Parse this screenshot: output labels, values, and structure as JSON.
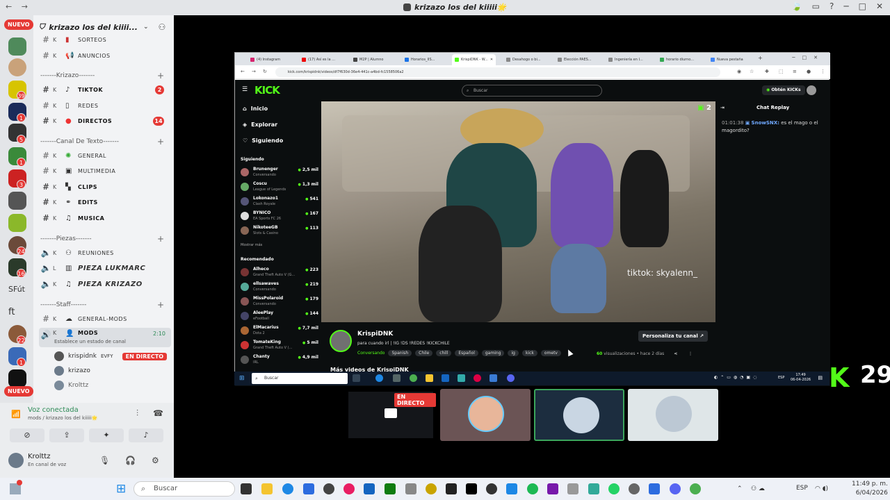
{
  "window": {
    "title": "krizazo los del kiiiii🌟",
    "back": "←",
    "forward": "→"
  },
  "rail": {
    "nuevo_top": "NUEVO",
    "nuevo_bottom": "NUEVO",
    "text_sfut": "SFút",
    "text_ft": "ft",
    "badges": [
      "39",
      "1",
      "5",
      "1",
      "3",
      "24",
      "16",
      "22",
      "1"
    ]
  },
  "server": {
    "name": "krizazo los del kiiii...",
    "categories": {
      "krizazo": "-------Krizazo-------",
      "texto": "-------Canal De Texto-------",
      "piezas": "-------Piezas-------",
      "staff": "-------Staff-------"
    },
    "channels": [
      {
        "k": "K",
        "label": "SORTEOS"
      },
      {
        "k": "K",
        "label": "ANUNCIOS"
      },
      {
        "k": "K",
        "label": "TIKTOK",
        "badge": "2"
      },
      {
        "k": "K",
        "label": "REDES"
      },
      {
        "k": "K",
        "label": "DIRECTOS",
        "badge": "14"
      },
      {
        "k": "K",
        "label": "GENERAL"
      },
      {
        "k": "K",
        "label": "MULTIMEDIA"
      },
      {
        "k": "K",
        "label": "CLIPS"
      },
      {
        "k": "K",
        "label": "EDITS"
      },
      {
        "k": "K",
        "label": "MUSICA"
      },
      {
        "k": "K",
        "label": "REUNIONES"
      },
      {
        "k": "L",
        "label": "PIEZA LUKMARC"
      },
      {
        "k": "K",
        "label": "PIEZA KRIZAZO"
      },
      {
        "k": "K",
        "label": "GENERAL-MODS"
      },
      {
        "k": "K",
        "label": "MODS",
        "time": "2:10",
        "status": "Establece un estado de canal"
      }
    ],
    "voice_users": [
      {
        "name": "krispidnk",
        "tag": "EVFY",
        "live": "EN DIRECTO"
      },
      {
        "name": "krizazo"
      },
      {
        "name": "Krolttz"
      }
    ]
  },
  "voice_panel": {
    "connected": "Voz conectada",
    "location": "mods / krizazo los del kiiiii🌟",
    "user_name": "Krolttz",
    "user_status": "En canal de voz"
  },
  "browser": {
    "tabs": [
      "(4) Instagram",
      "(17) Así es la ...",
      "M2P | Alumno",
      "Horarios_IIS...",
      "KrispiDNK - W...",
      "Desahogo o bi...",
      "Elección PAES...",
      "Ingeniería en I...",
      "horario diurno...",
      "Nueva pestaña"
    ],
    "url": "kick.com/krispidnk/videos/df7f630d-36e4-441c-a4bd-fc1558506a2"
  },
  "kick": {
    "logo": "KICK",
    "search_placeholder": "Buscar",
    "kicks_button": "Obtén KICKs",
    "nav": [
      "Inicio",
      "Explorar",
      "Siguiendo"
    ],
    "following_title": "Siguiendo",
    "following": [
      {
        "name": "Brunenger",
        "game": "Conversando",
        "viewers": "2,5 mil"
      },
      {
        "name": "Coscu",
        "game": "League of Legends",
        "viewers": "1,3 mil"
      },
      {
        "name": "Lokonazo1",
        "game": "Clash Royale",
        "viewers": "541"
      },
      {
        "name": "BYNICO",
        "game": "EA Sports FC 26",
        "viewers": "167"
      },
      {
        "name": "NikoteeGB",
        "game": "Slots & Casino",
        "viewers": "113"
      }
    ],
    "show_more": "Mostrar más",
    "recommended_title": "Recomendado",
    "recommended": [
      {
        "name": "Alheco",
        "game": "Grand Theft Auto V (G...",
        "viewers": "223"
      },
      {
        "name": "ellsawaves",
        "game": "Conversando",
        "viewers": "219"
      },
      {
        "name": "MissPolaroid",
        "game": "Conversando",
        "viewers": "179"
      },
      {
        "name": "AleePlay",
        "game": "eFootball",
        "viewers": "144"
      },
      {
        "name": "ElMacarius",
        "game": "Dota 2",
        "viewers": "7,7 mil"
      },
      {
        "name": "TomateKing",
        "game": "Grand Theft Auto V (...",
        "viewers": "5 mil"
      },
      {
        "name": "Chanty",
        "game": "IRL",
        "viewers": "4,9 mil"
      }
    ],
    "video_watermark": "tiktok: skyalenn_",
    "video_badge": "2",
    "chat_title": "Chat Replay",
    "chat_time": "01:01:38",
    "chat_user": "SnowSNX:",
    "chat_text": "es el mago o el magordito?",
    "channel_name": "KrispiDNK",
    "stream_title": "para cuando irl | !IG !DS !REDES !KICKCHILE",
    "category": "Conversando",
    "tags": [
      "Spanish",
      "Chile",
      "chill",
      "Español",
      "gaming",
      "ig",
      "kick",
      "ometv"
    ],
    "views": "60",
    "views_label": "visualizaciones",
    "time_ago": "hace 2 días",
    "customize": "Personaliza tu canal",
    "more_videos": "Más videos de KrispiDNK"
  },
  "inner_taskbar": {
    "search": "Buscar",
    "lang": "ESP",
    "time": "17:49",
    "date": "06-04-2026"
  },
  "overlay": {
    "k_logo": "K",
    "k_number": "29"
  },
  "tiles": {
    "live": "EN DIRECTO"
  },
  "taskbar": {
    "search": "Buscar",
    "lang": "ESP",
    "time": "11:49 p. m.",
    "date": "6/04/2026"
  },
  "colors": {
    "kick_green": "#53fc18",
    "discord_red": "#e53935",
    "voice_green": "#2e8b57"
  }
}
